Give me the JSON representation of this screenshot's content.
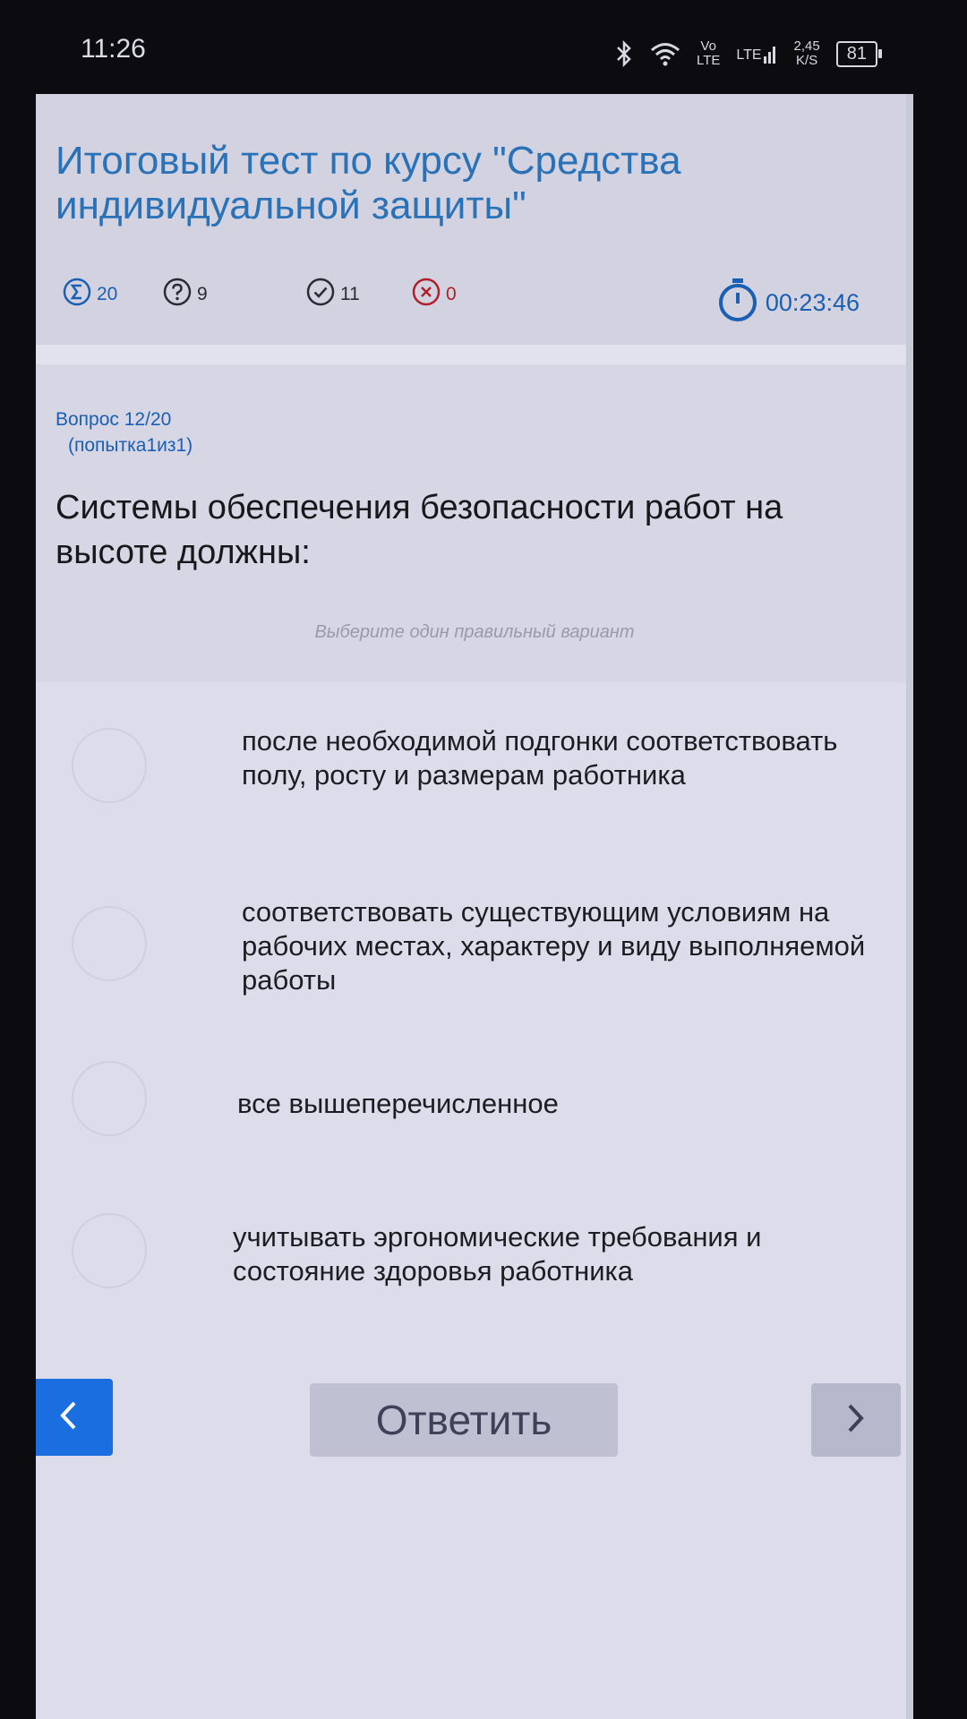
{
  "status_bar": {
    "time": "11:26",
    "volte": "Vo\nLTE",
    "lte": "LTE",
    "speed": "2,45\nK/S",
    "battery": "81"
  },
  "header": {
    "title": "Итоговый тест по курсу \"Средства индивидуальной защиты\""
  },
  "stats": {
    "total": "20",
    "remaining": "9",
    "correct": "11",
    "wrong": "0",
    "timer": "00:23:46"
  },
  "question": {
    "number": "Вопрос 12/20",
    "attempt": "(попытка1из1)",
    "text": "Системы обеспечения безопасности работ на высоте должны:",
    "hint": "Выберите один правильный вариант"
  },
  "options": [
    "после необходимой подгонки соответствовать полу, росту и размерам работника",
    "соответствовать существующим условиям на рабочих местах, характеру и виду выполняемой работы",
    "все вышеперечисленное",
    "учитывать эргономические требования и состояние здоровья работника"
  ],
  "footer": {
    "answer_label": "Ответить"
  },
  "colors": {
    "accent": "#1a6ee0",
    "title": "#2a72b8",
    "wrong": "#b0202c"
  }
}
